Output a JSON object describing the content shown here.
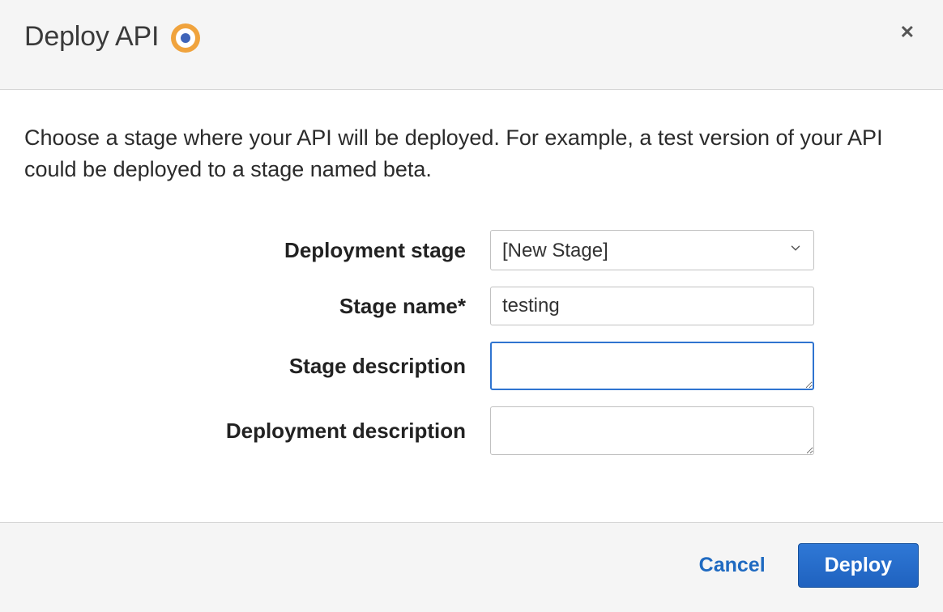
{
  "dialog": {
    "title": "Deploy API",
    "helptext": "Choose a stage where your API will be deployed. For example, a test version of your API could be deployed to a stage named beta."
  },
  "form": {
    "deployment_stage": {
      "label": "Deployment stage",
      "value": "[New Stage]"
    },
    "stage_name": {
      "label": "Stage name*",
      "value": "testing"
    },
    "stage_description": {
      "label": "Stage description",
      "value": ""
    },
    "deployment_description": {
      "label": "Deployment description",
      "value": ""
    }
  },
  "actions": {
    "cancel": "Cancel",
    "deploy": "Deploy"
  }
}
